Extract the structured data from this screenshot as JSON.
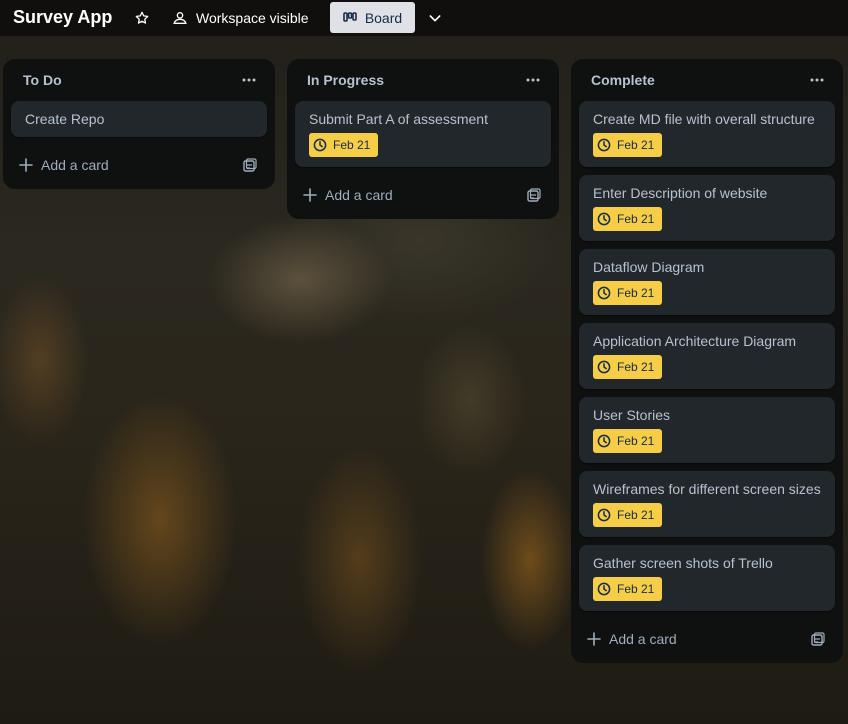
{
  "header": {
    "board_title": "Survey App",
    "visibility_label": "Workspace visible",
    "view_label": "Board"
  },
  "lists": [
    {
      "title": "To Do",
      "cards": [
        {
          "title": "Create Repo"
        }
      ],
      "add_card_label": "Add a card"
    },
    {
      "title": "In Progress",
      "cards": [
        {
          "title": "Submit Part A of assessment",
          "due": "Feb 21"
        }
      ],
      "add_card_label": "Add a card"
    },
    {
      "title": "Complete",
      "cards": [
        {
          "title": "Create MD file with overall structure",
          "due": "Feb 21"
        },
        {
          "title": "Enter Description of website",
          "due": "Feb 21"
        },
        {
          "title": "Dataflow Diagram",
          "due": "Feb 21"
        },
        {
          "title": "Application Architecture Diagram",
          "due": "Feb 21"
        },
        {
          "title": "User Stories",
          "due": "Feb 21"
        },
        {
          "title": "Wireframes for different screen sizes",
          "due": "Feb 21"
        },
        {
          "title": "Gather screen shots of Trello",
          "due": "Feb 21"
        }
      ],
      "add_card_label": "Add a card"
    }
  ],
  "colors": {
    "due_badge": "#f5cd47",
    "card_bg": "#22272b",
    "list_bg": "#0f1010"
  }
}
